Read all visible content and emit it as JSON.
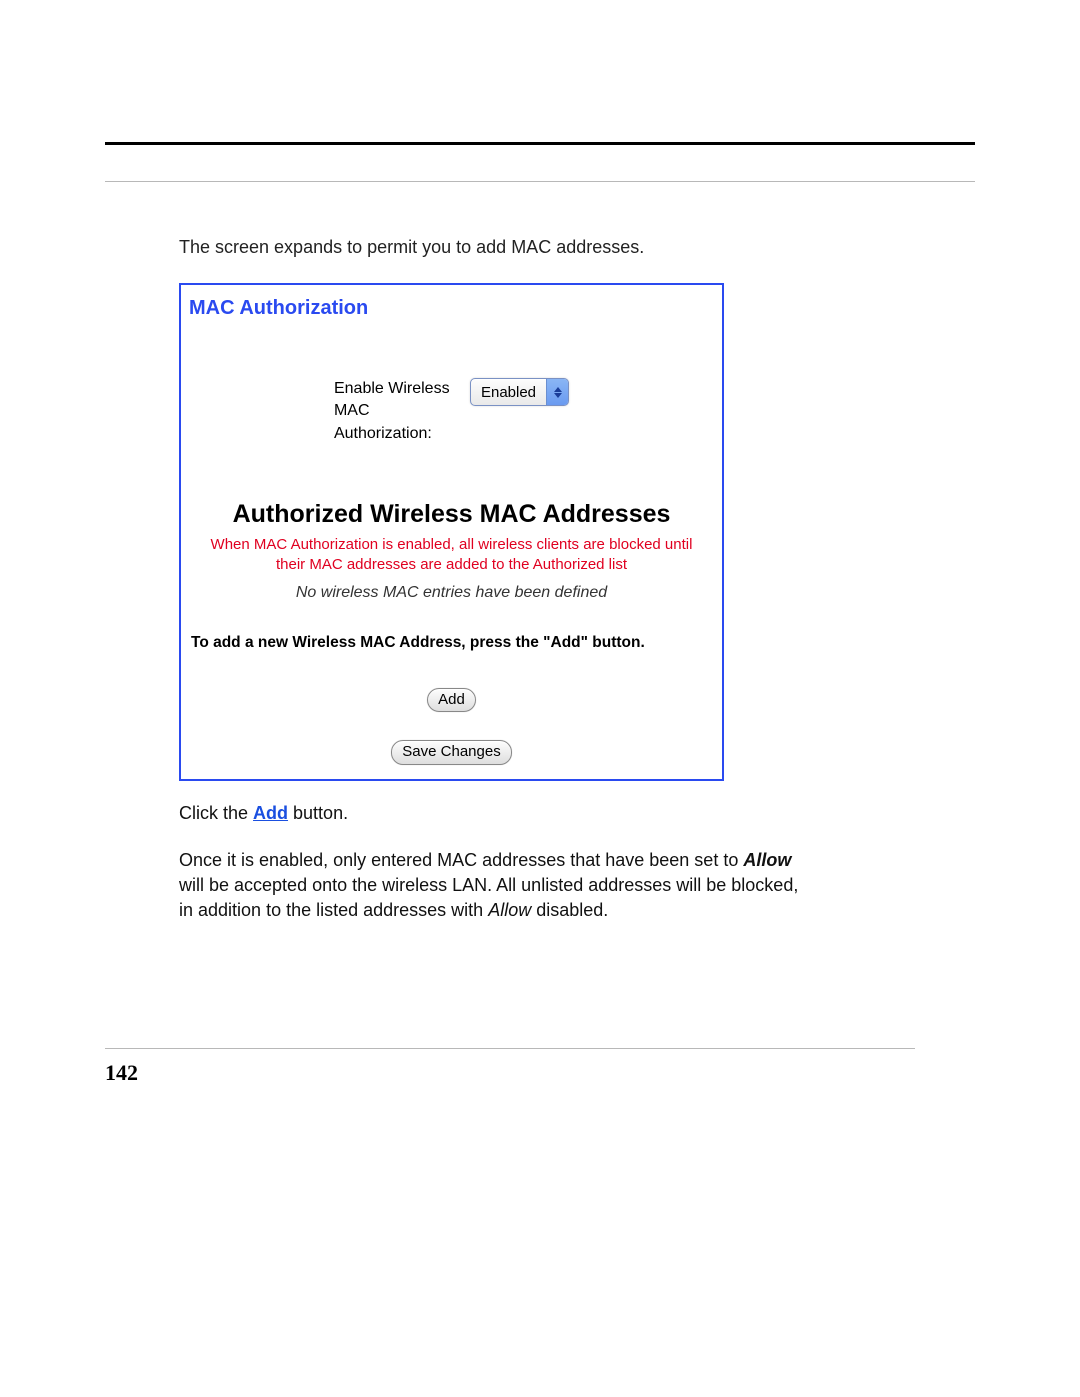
{
  "intro": "The screen expands to permit you to add MAC addresses.",
  "panel": {
    "title": "MAC Authorization",
    "enable_label": "Enable Wireless MAC Authorization:",
    "enable_value": "Enabled",
    "section_title": "Authorized Wireless MAC Addresses",
    "warning": "When MAC Authorization is enabled, all wireless clients are blocked until their MAC addresses are added to the Authorized list",
    "empty_msg": "No wireless MAC entries have been defined",
    "instruction": "To add a new Wireless MAC Address, press the \"Add\" button.",
    "add_label": "Add",
    "save_label": "Save Changes"
  },
  "click": {
    "prefix": "Click the ",
    "link": "Add",
    "suffix": " button."
  },
  "paragraph": {
    "p1": "Once it is enabled, only entered MAC addresses that have been set to ",
    "allow": "Allow",
    "p2": " will be accepted onto the wireless LAN. All unlisted addresses will be blocked, in addition to the listed addresses with ",
    "allow2": "Allow",
    "p3": " disabled."
  },
  "page_number": "142"
}
